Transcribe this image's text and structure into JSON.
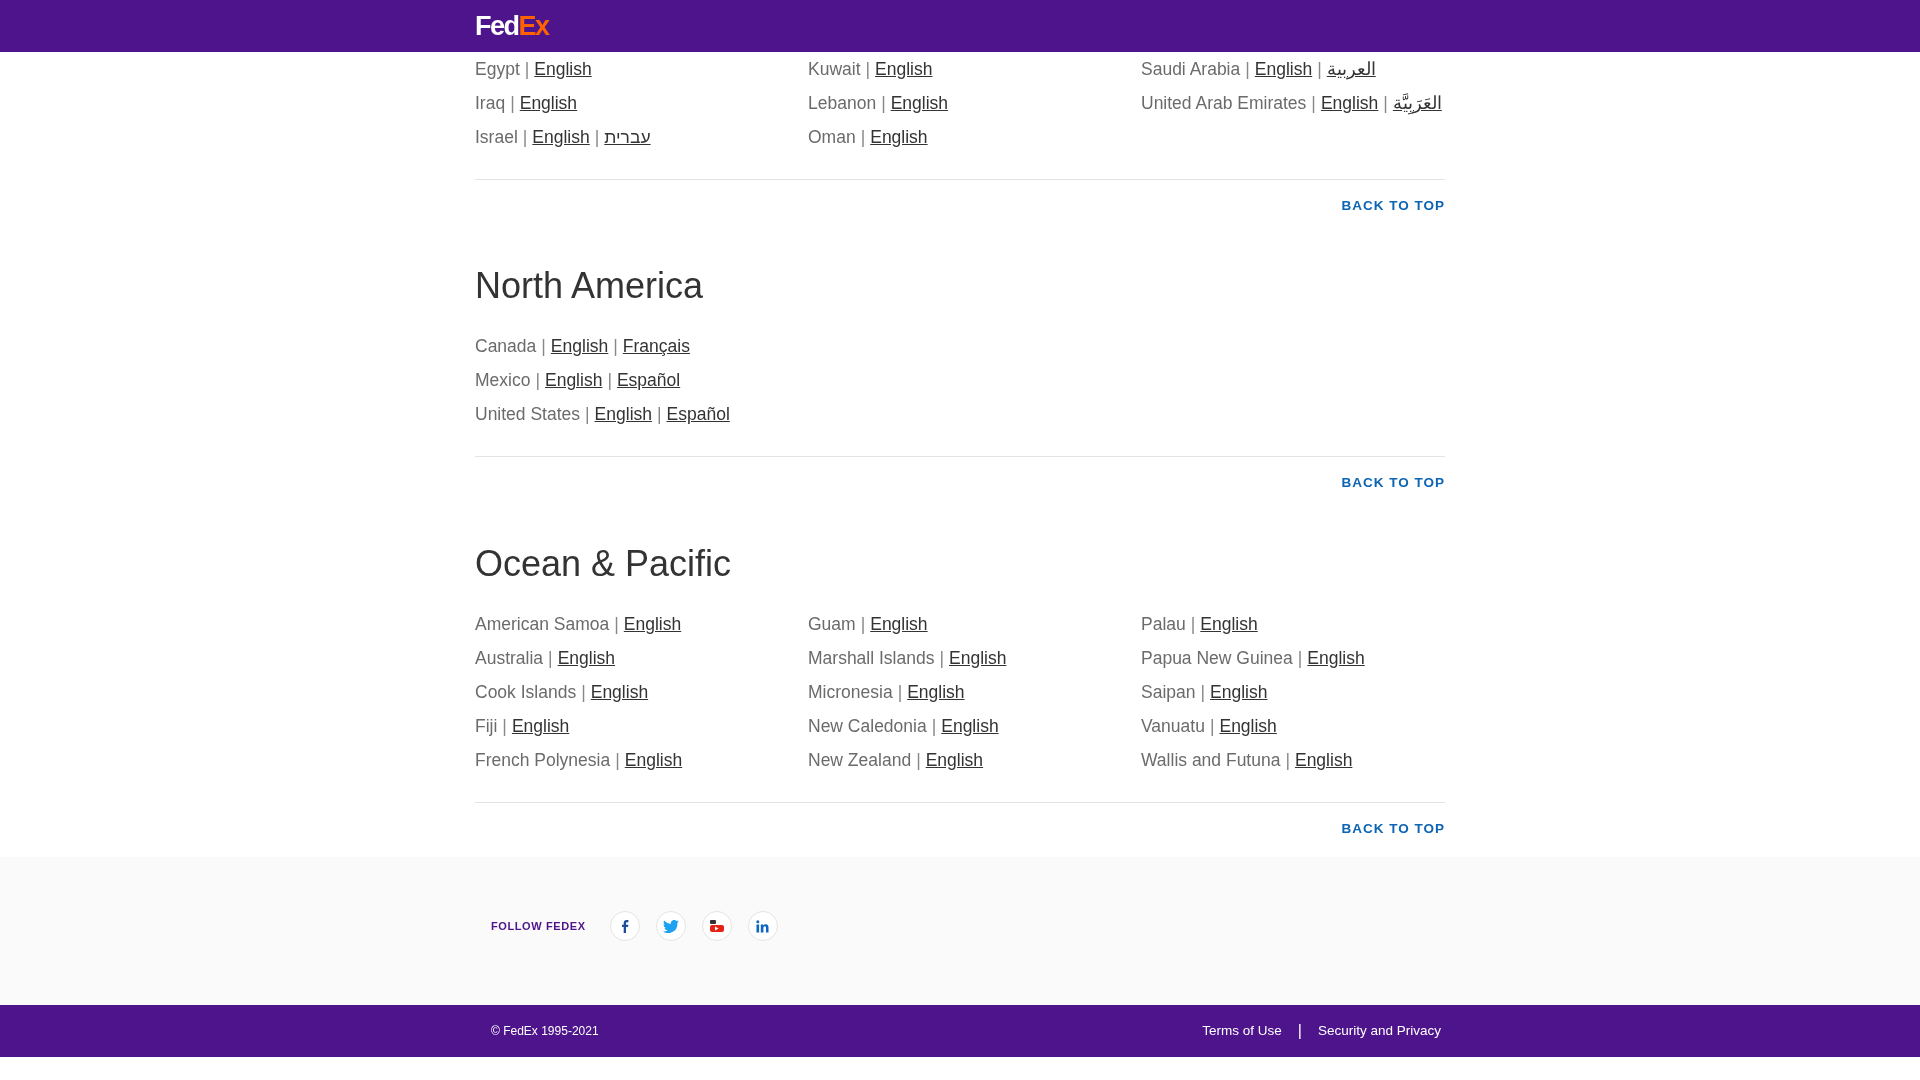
{
  "header": {
    "logo": [
      "Fed",
      "Ex"
    ]
  },
  "separator": "|",
  "sections": [
    {
      "columns": [
        [
          {
            "country": "Egypt",
            "links": [
              "English"
            ]
          },
          {
            "country": "Iraq",
            "links": [
              "English"
            ]
          },
          {
            "country": "Israel",
            "links": [
              "English",
              "עברית"
            ]
          }
        ],
        [
          {
            "country": "Kuwait",
            "links": [
              "English"
            ]
          },
          {
            "country": "Lebanon",
            "links": [
              "English"
            ]
          },
          {
            "country": "Oman",
            "links": [
              "English"
            ]
          }
        ],
        [
          {
            "country": "Saudi Arabia",
            "links": [
              "English",
              "العربية"
            ]
          },
          {
            "country": "United Arab Emirates",
            "links": [
              "English",
              "العَرَبِيَّة"
            ]
          }
        ]
      ],
      "back_to_top": "BACK TO TOP"
    },
    {
      "heading": "North America",
      "columns": [
        [
          {
            "country": "Canada",
            "links": [
              "English",
              "Français"
            ]
          },
          {
            "country": "Mexico",
            "links": [
              "English",
              "Español"
            ]
          },
          {
            "country": "United States",
            "links": [
              "English",
              "Español"
            ]
          }
        ]
      ],
      "back_to_top": "BACK TO TOP"
    },
    {
      "heading": "Ocean & Pacific",
      "columns": [
        [
          {
            "country": "American Samoa",
            "links": [
              "English"
            ]
          },
          {
            "country": "Australia",
            "links": [
              "English"
            ]
          },
          {
            "country": "Cook Islands",
            "links": [
              "English"
            ]
          },
          {
            "country": "Fiji",
            "links": [
              "English"
            ]
          },
          {
            "country": "French Polynesia",
            "links": [
              "English"
            ]
          }
        ],
        [
          {
            "country": "Guam",
            "links": [
              "English"
            ]
          },
          {
            "country": "Marshall Islands",
            "links": [
              "English"
            ]
          },
          {
            "country": "Micronesia",
            "links": [
              "English"
            ]
          },
          {
            "country": "New Caledonia",
            "links": [
              "English"
            ]
          },
          {
            "country": "New Zealand",
            "links": [
              "English"
            ]
          }
        ],
        [
          {
            "country": "Palau",
            "links": [
              "English"
            ]
          },
          {
            "country": "Papua New Guinea",
            "links": [
              "English"
            ]
          },
          {
            "country": "Saipan",
            "links": [
              "English"
            ]
          },
          {
            "country": "Vanuatu",
            "links": [
              "English"
            ]
          },
          {
            "country": "Wallis and Futuna",
            "links": [
              "English"
            ]
          }
        ]
      ],
      "back_to_top": "BACK TO TOP"
    }
  ],
  "follow": {
    "label": "FOLLOW FEDEX",
    "networks": [
      {
        "kind": "facebook"
      },
      {
        "kind": "twitter"
      },
      {
        "kind": "youtube"
      },
      {
        "kind": "linkedin"
      }
    ]
  },
  "footer": {
    "copyright": "© FedEx 1995-2021",
    "links": [
      "Terms of Use",
      "Security and Privacy"
    ],
    "divider": "|"
  }
}
